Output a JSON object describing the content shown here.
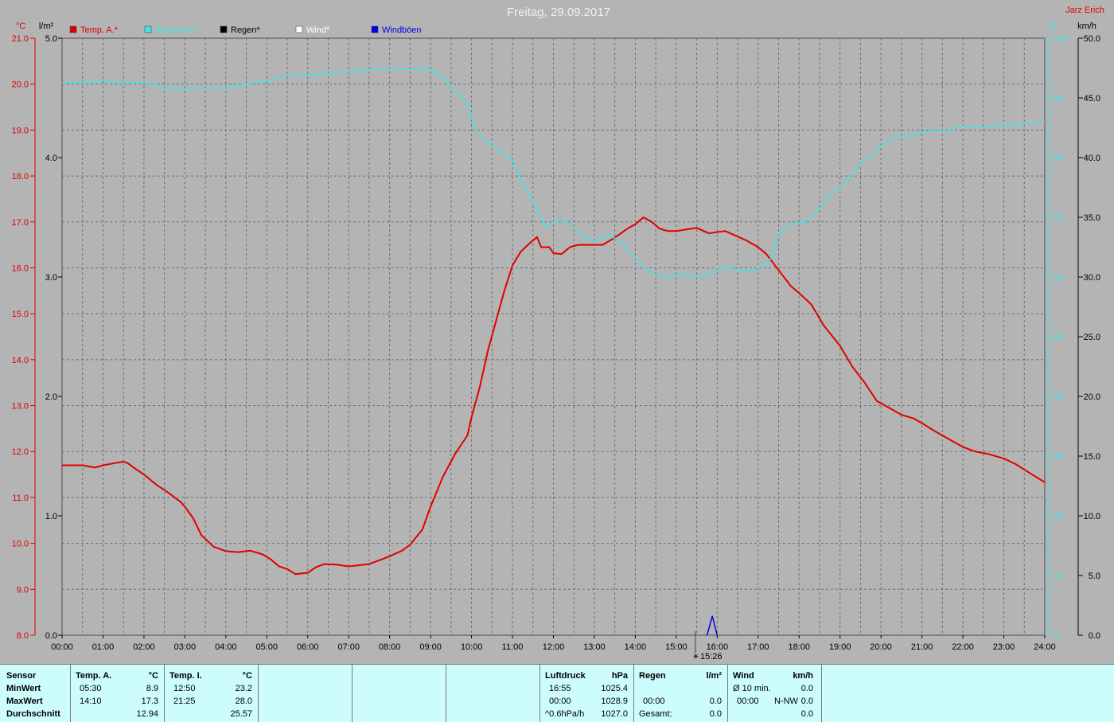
{
  "header": {
    "title": "Freitag, 29.09.2017",
    "author": "Jarz Erich",
    "unit_temp": "°C",
    "unit_rain": "l/m²",
    "unit_humidity": "%",
    "unit_wind": "km/h",
    "cursor_time": "15:26"
  },
  "legend": [
    {
      "label": "Temp. A.*",
      "color": "#e00000"
    },
    {
      "label": "Feuchte A.*",
      "color": "#3ce6e6"
    },
    {
      "label": "Regen*",
      "color": "#000000"
    },
    {
      "label": "Wind*",
      "color": "#ffffff"
    },
    {
      "label": "Windböen",
      "color": "#0000e6"
    }
  ],
  "chart_data": {
    "type": "line",
    "title": "Freitag, 29.09.2017",
    "x_ticks": [
      "00:00",
      "01:00",
      "02:00",
      "03:00",
      "04:00",
      "05:00",
      "06:00",
      "07:00",
      "08:00",
      "09:00",
      "10:00",
      "11:00",
      "12:00",
      "13:00",
      "14:00",
      "15:00",
      "16:00",
      "17:00",
      "18:00",
      "19:00",
      "20:00",
      "21:00",
      "22:00",
      "23:00",
      "24:00"
    ],
    "xlim": [
      0,
      24
    ],
    "axes": {
      "temp": {
        "label": "°C",
        "ylim": [
          8.0,
          21.0
        ],
        "ticks": [
          "8.0",
          "9.0",
          "10.0",
          "11.0",
          "12.0",
          "13.0",
          "14.0",
          "15.0",
          "16.0",
          "17.0",
          "18.0",
          "19.0",
          "20.0",
          "21.0"
        ]
      },
      "rain": {
        "label": "l/m²",
        "ylim": [
          0.0,
          5.0
        ],
        "ticks": [
          "0.0",
          "1.0",
          "2.0",
          "3.0",
          "4.0",
          "5.0"
        ]
      },
      "humidity": {
        "label": "%",
        "ylim": [
          0,
          100
        ],
        "ticks": [
          "0",
          "10",
          "20",
          "30",
          "40",
          "50",
          "60",
          "70",
          "80",
          "90",
          "100"
        ]
      },
      "wind": {
        "label": "km/h",
        "ylim": [
          0.0,
          50.0
        ],
        "ticks": [
          "0.0",
          "5.0",
          "10.0",
          "15.0",
          "20.0",
          "25.0",
          "30.0",
          "35.0",
          "40.0",
          "45.0",
          "50.0"
        ]
      }
    },
    "grid": true,
    "series": [
      {
        "name": "Temp. A.*",
        "axis": "temp",
        "color": "#e00000",
        "points": [
          [
            0,
            11.7
          ],
          [
            0.5,
            11.7
          ],
          [
            0.8,
            11.65
          ],
          [
            1.0,
            11.7
          ],
          [
            1.3,
            11.75
          ],
          [
            1.5,
            11.78
          ],
          [
            1.6,
            11.75
          ],
          [
            1.8,
            11.62
          ],
          [
            2.0,
            11.5
          ],
          [
            2.3,
            11.28
          ],
          [
            2.6,
            11.1
          ],
          [
            2.9,
            10.9
          ],
          [
            3.0,
            10.8
          ],
          [
            3.2,
            10.55
          ],
          [
            3.4,
            10.18
          ],
          [
            3.7,
            9.93
          ],
          [
            4.0,
            9.83
          ],
          [
            4.3,
            9.81
          ],
          [
            4.6,
            9.84
          ],
          [
            4.9,
            9.76
          ],
          [
            5.1,
            9.65
          ],
          [
            5.3,
            9.5
          ],
          [
            5.5,
            9.44
          ],
          [
            5.7,
            9.33
          ],
          [
            6.0,
            9.36
          ],
          [
            6.2,
            9.48
          ],
          [
            6.4,
            9.55
          ],
          [
            6.7,
            9.54
          ],
          [
            7.0,
            9.5
          ],
          [
            7.5,
            9.55
          ],
          [
            7.8,
            9.65
          ],
          [
            8.0,
            9.72
          ],
          [
            8.3,
            9.84
          ],
          [
            8.5,
            9.97
          ],
          [
            8.8,
            10.3
          ],
          [
            9.0,
            10.8
          ],
          [
            9.3,
            11.45
          ],
          [
            9.6,
            11.95
          ],
          [
            9.9,
            12.35
          ],
          [
            10.0,
            12.75
          ],
          [
            10.2,
            13.4
          ],
          [
            10.4,
            14.2
          ],
          [
            10.6,
            14.85
          ],
          [
            10.8,
            15.5
          ],
          [
            11.0,
            16.05
          ],
          [
            11.2,
            16.35
          ],
          [
            11.4,
            16.52
          ],
          [
            11.6,
            16.67
          ],
          [
            11.7,
            16.45
          ],
          [
            11.9,
            16.45
          ],
          [
            12.0,
            16.32
          ],
          [
            12.2,
            16.3
          ],
          [
            12.4,
            16.45
          ],
          [
            12.6,
            16.5
          ],
          [
            12.8,
            16.5
          ],
          [
            13.0,
            16.5
          ],
          [
            13.2,
            16.5
          ],
          [
            13.4,
            16.6
          ],
          [
            13.6,
            16.72
          ],
          [
            13.8,
            16.85
          ],
          [
            14.0,
            16.95
          ],
          [
            14.2,
            17.1
          ],
          [
            14.4,
            17.0
          ],
          [
            14.6,
            16.85
          ],
          [
            14.8,
            16.8
          ],
          [
            15.0,
            16.8
          ],
          [
            15.2,
            16.83
          ],
          [
            15.5,
            16.87
          ],
          [
            15.8,
            16.75
          ],
          [
            16.0,
            16.78
          ],
          [
            16.2,
            16.8
          ],
          [
            16.4,
            16.72
          ],
          [
            16.7,
            16.6
          ],
          [
            17.0,
            16.45
          ],
          [
            17.2,
            16.3
          ],
          [
            17.5,
            15.95
          ],
          [
            17.8,
            15.6
          ],
          [
            18.0,
            15.45
          ],
          [
            18.3,
            15.2
          ],
          [
            18.6,
            14.75
          ],
          [
            19.0,
            14.3
          ],
          [
            19.3,
            13.85
          ],
          [
            19.6,
            13.5
          ],
          [
            19.9,
            13.1
          ],
          [
            20.2,
            12.95
          ],
          [
            20.5,
            12.8
          ],
          [
            20.8,
            12.72
          ],
          [
            21.0,
            12.62
          ],
          [
            21.3,
            12.45
          ],
          [
            21.6,
            12.3
          ],
          [
            22.0,
            12.1
          ],
          [
            22.3,
            12.0
          ],
          [
            22.6,
            11.95
          ],
          [
            23.0,
            11.85
          ],
          [
            23.3,
            11.72
          ],
          [
            23.6,
            11.55
          ],
          [
            24.0,
            11.33
          ]
        ]
      },
      {
        "name": "Feuchte A.*",
        "axis": "humidity",
        "color": "#3ce6e6",
        "points": [
          [
            0,
            92.5
          ],
          [
            0.5,
            92.5
          ],
          [
            1.0,
            92.9
          ],
          [
            1.5,
            92.5
          ],
          [
            2.0,
            92.6
          ],
          [
            2.5,
            91.8
          ],
          [
            3.0,
            91.5
          ],
          [
            3.5,
            91.6
          ],
          [
            4.0,
            91.7
          ],
          [
            4.5,
            92.3
          ],
          [
            5.0,
            92.8
          ],
          [
            5.5,
            93.7
          ],
          [
            6.0,
            93.9
          ],
          [
            6.5,
            94.0
          ],
          [
            7.0,
            94.4
          ],
          [
            7.5,
            94.8
          ],
          [
            8.0,
            94.9
          ],
          [
            8.5,
            94.8
          ],
          [
            9.0,
            94.7
          ],
          [
            9.3,
            93.5
          ],
          [
            9.6,
            91.0
          ],
          [
            9.9,
            89.0
          ],
          [
            10.1,
            84.5
          ],
          [
            10.5,
            82.0
          ],
          [
            10.8,
            80.5
          ],
          [
            11.0,
            79.5
          ],
          [
            11.3,
            75.0
          ],
          [
            11.6,
            71.5
          ],
          [
            11.8,
            68.5
          ],
          [
            12.1,
            69.5
          ],
          [
            12.4,
            69.0
          ],
          [
            12.7,
            67.0
          ],
          [
            13.0,
            66.0
          ],
          [
            13.3,
            67.0
          ],
          [
            13.5,
            66.5
          ],
          [
            13.7,
            65.5
          ],
          [
            13.9,
            64.0
          ],
          [
            14.1,
            62.5
          ],
          [
            14.4,
            60.5
          ],
          [
            14.8,
            60.0
          ],
          [
            15.2,
            60.5
          ],
          [
            15.5,
            60.0
          ],
          [
            15.8,
            60.3
          ],
          [
            16.0,
            61.5
          ],
          [
            16.3,
            61.5
          ],
          [
            16.7,
            61.0
          ],
          [
            17.0,
            61.5
          ],
          [
            17.3,
            63.0
          ],
          [
            17.5,
            67.0
          ],
          [
            17.8,
            69.0
          ],
          [
            18.0,
            69.0
          ],
          [
            18.2,
            69.5
          ],
          [
            18.5,
            71.5
          ],
          [
            18.8,
            74.0
          ],
          [
            19.0,
            75.0
          ],
          [
            19.2,
            76.5
          ],
          [
            19.5,
            79.0
          ],
          [
            19.8,
            80.5
          ],
          [
            20.0,
            82.0
          ],
          [
            20.3,
            83.2
          ],
          [
            20.8,
            83.8
          ],
          [
            21.2,
            84.5
          ],
          [
            21.6,
            84.5
          ],
          [
            22.0,
            85.3
          ],
          [
            22.5,
            85.0
          ],
          [
            23.0,
            85.5
          ],
          [
            23.5,
            85.6
          ],
          [
            24.0,
            86.0
          ]
        ]
      },
      {
        "name": "Windböen",
        "axis": "wind",
        "color": "#0000e6",
        "points": [
          [
            15.75,
            0
          ],
          [
            15.88,
            1.6
          ],
          [
            16.0,
            0
          ]
        ]
      }
    ]
  },
  "stats": {
    "sensor": {
      "title": "Sensor",
      "rows": [
        "MinWert",
        "MaxWert",
        "Durchschnitt"
      ]
    },
    "temp_a": {
      "title": "Temp. A.",
      "unit": "°C",
      "min_time": "05:30",
      "min": "8.9",
      "max_time": "14:10",
      "max": "17.3",
      "avg": "12.94"
    },
    "temp_i": {
      "title": "Temp. I.",
      "unit": "°C",
      "min_time": "12:50",
      "min": "23.2",
      "max_time": "21:25",
      "max": "28.0",
      "avg": "25.57"
    },
    "pressure": {
      "title": "Luftdruck",
      "unit": "hPa",
      "min_time": "16:55",
      "min": "1025.4",
      "max_time": "00:00",
      "max": "1028.9",
      "trend": "^0.6hPa/h",
      "avg": "1027.0"
    },
    "rain": {
      "title": "Regen",
      "unit": "l/m²",
      "max_time": "00:00",
      "max": "0.0",
      "total_label": "Gesamt:",
      "total": "0.0"
    },
    "wind": {
      "title": "Wind",
      "unit": "km/h",
      "avg_label": "Ø 10 min.",
      "avg": "0.0",
      "max_time": "00:00",
      "max_dir": "N-NW",
      "max": "0.0",
      "total": "0.0"
    }
  }
}
